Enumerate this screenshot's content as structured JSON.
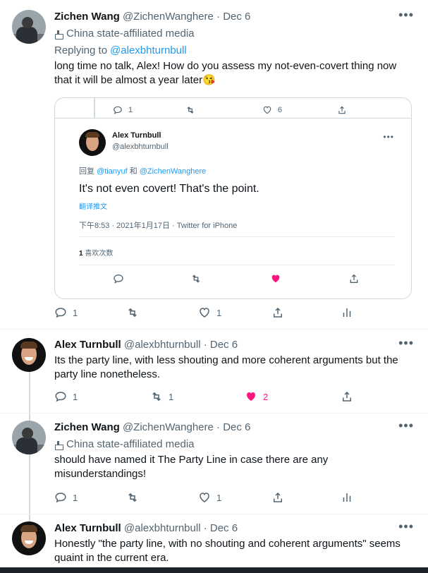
{
  "tweets": [
    {
      "name": "Zichen Wang",
      "handle": "@ZichenWanghere",
      "date": "· Dec 6",
      "label": "China state-affiliated media",
      "replying_prefix": "Replying to ",
      "replying_handle": "@alexbhturnbull",
      "text": "long time no talk, Alex! How do you assess my not-even-covert thing now that it will be almost a year later😘",
      "replies": "1",
      "retweets": "",
      "likes": "1"
    },
    {
      "name": "Alex Turnbull",
      "handle": "@alexbhturnbull",
      "date": "· Dec 6",
      "text": "Its the party line, with less shouting and more coherent arguments but the party line nonetheless.",
      "replies": "1",
      "retweets": "1",
      "likes": "2"
    },
    {
      "name": "Zichen Wang",
      "handle": "@ZichenWanghere",
      "date": "· Dec 6",
      "label": "China state-affiliated media",
      "text": "should have named it The Party Line in case there are any misunderstandings!",
      "replies": "1",
      "retweets": "",
      "likes": "1"
    },
    {
      "name": "Alex Turnbull",
      "handle": "@alexbhturnbull",
      "date": "· Dec 6",
      "text": "Honestly \"the party line, with no shouting and coherent arguments\" seems quaint in the current era."
    }
  ],
  "quote": {
    "top_replies": "1",
    "top_likes": "6",
    "name": "Alex Turnbull",
    "handle": "@alexbhturnbull",
    "reply_prefix": "回复 ",
    "reply_handle1": "@tianyuf",
    "reply_join": " 和 ",
    "reply_handle2": "@ZichenWanghere",
    "text": "It's not even covert! That's the point.",
    "translate": "翻译推文",
    "meta": "下午8:53 · 2021年1月17日 · Twitter for iPhone",
    "likes_count": "1",
    "likes_label": " 喜欢次数"
  },
  "icons": [
    "reply-icon",
    "retweet-icon",
    "like-icon",
    "share-icon",
    "analytics-icon",
    "more-icon",
    "state-media-icon"
  ],
  "colors": {
    "accent": "#1d9bf0",
    "like": "#f91880",
    "muted": "#536471"
  }
}
